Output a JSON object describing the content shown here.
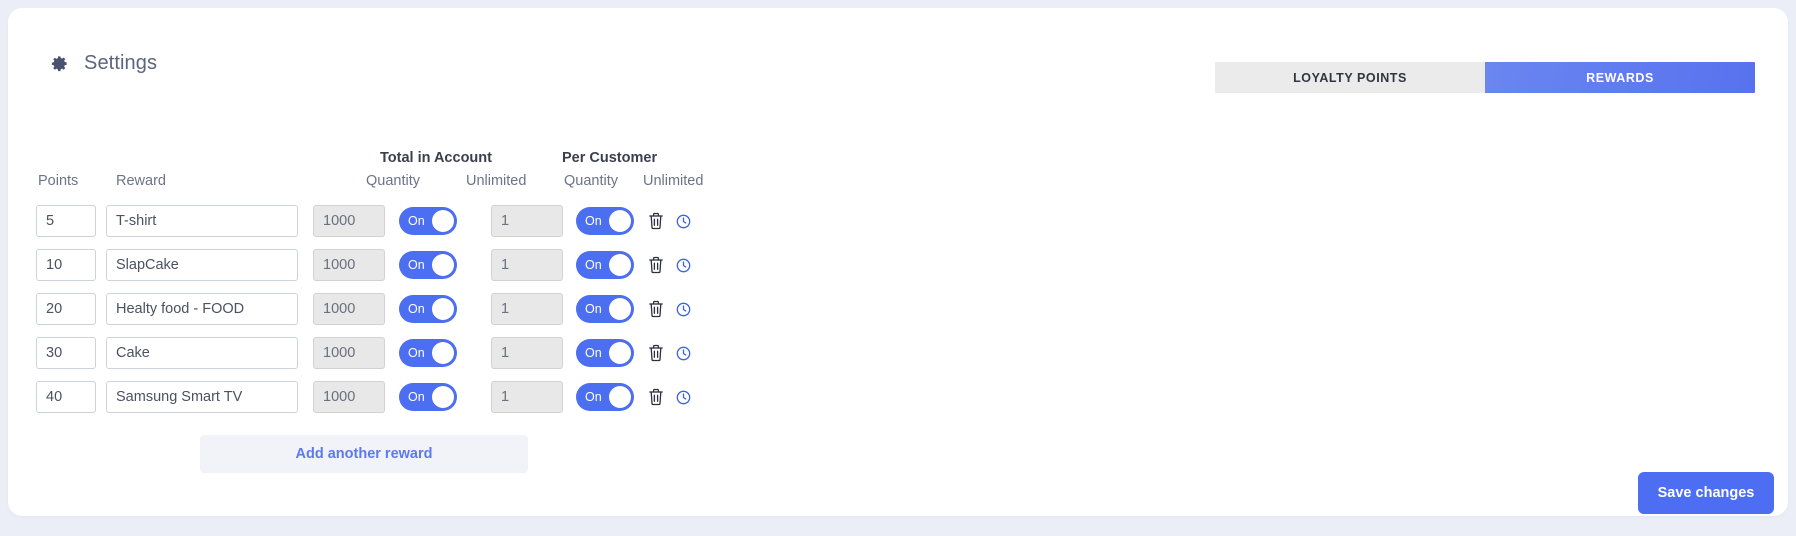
{
  "header": {
    "title": "Settings",
    "gear_icon": "gear-icon"
  },
  "tabs": [
    {
      "label": "LOYALTY POINTS",
      "active": false
    },
    {
      "label": "REWARDS",
      "active": true
    }
  ],
  "table": {
    "group_headers": {
      "total_in_account": "Total in Account",
      "per_customer": "Per Customer"
    },
    "columns": {
      "points": "Points",
      "reward": "Reward",
      "total_quantity": "Quantity",
      "total_unlimited": "Unlimited",
      "per_quantity": "Quantity",
      "per_unlimited": "Unlimited"
    },
    "rows": [
      {
        "points": "5",
        "reward": "T-shirt",
        "total_quantity": "1000",
        "total_unlimited": "On",
        "per_quantity": "1",
        "per_unlimited": "On",
        "delete_icon": "trash-icon",
        "history_icon": "clock-icon"
      },
      {
        "points": "10",
        "reward": "SlapCake",
        "total_quantity": "1000",
        "total_unlimited": "On",
        "per_quantity": "1",
        "per_unlimited": "On",
        "delete_icon": "trash-icon",
        "history_icon": "clock-icon"
      },
      {
        "points": "20",
        "reward": "Healty food - FOOD",
        "total_quantity": "1000",
        "total_unlimited": "On",
        "per_quantity": "1",
        "per_unlimited": "On",
        "delete_icon": "trash-icon",
        "history_icon": "clock-icon"
      },
      {
        "points": "30",
        "reward": "Cake",
        "total_quantity": "1000",
        "total_unlimited": "On",
        "per_quantity": "1",
        "per_unlimited": "On",
        "delete_icon": "trash-icon",
        "history_icon": "clock-icon"
      },
      {
        "points": "40",
        "reward": "Samsung Smart TV",
        "total_quantity": "1000",
        "total_unlimited": "On",
        "per_quantity": "1",
        "per_unlimited": "On",
        "delete_icon": "trash-icon",
        "history_icon": "clock-icon"
      }
    ]
  },
  "actions": {
    "add_reward": "Add another reward",
    "save_changes": "Save changes"
  },
  "colors": {
    "accent": "#4d6ef2",
    "tab_active": "#5872ef",
    "tab_inactive": "#ebebeb",
    "page_background": "#eceef7",
    "card_background": "#ffffff",
    "add_button_background": "#f1f3f9",
    "disabled_field": "#e8e8e8",
    "title_text": "#5b6480"
  }
}
